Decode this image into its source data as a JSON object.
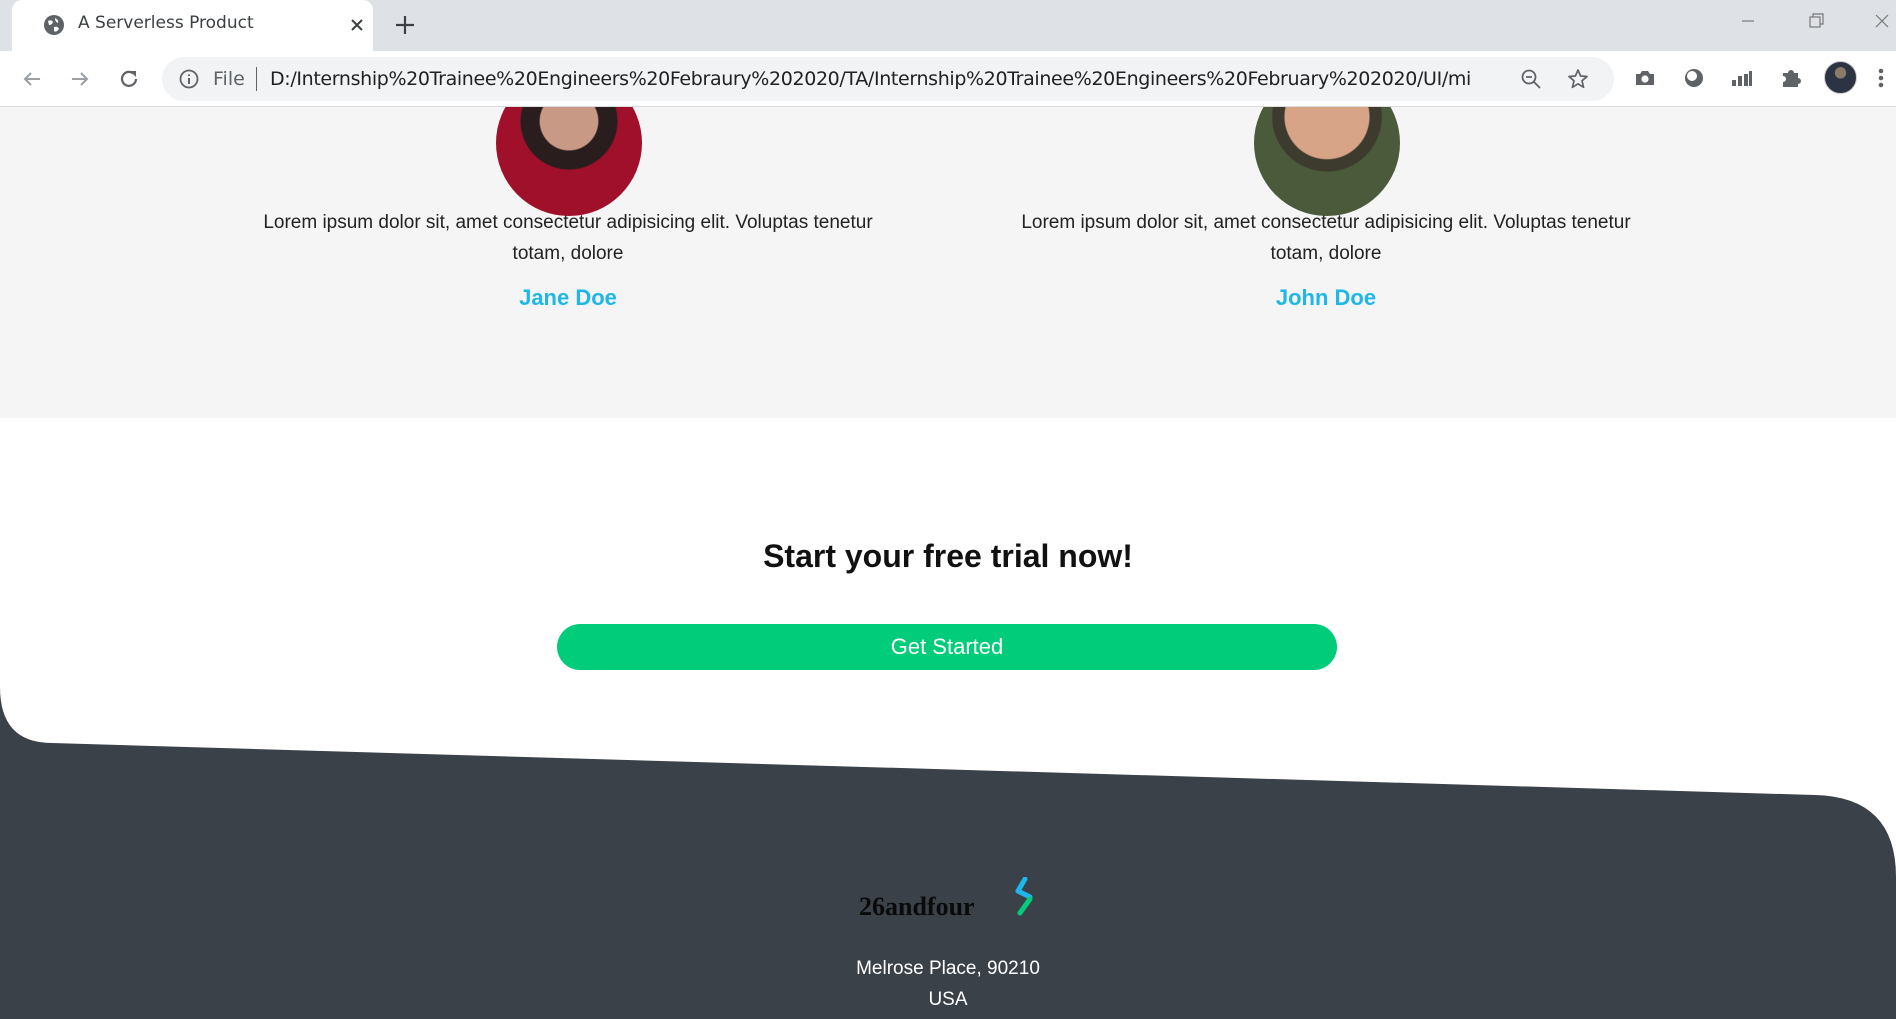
{
  "browser": {
    "tab_title": "A Serverless Product",
    "address_prefix": "File",
    "url": "D:/Internship%20Trainee%20Engineers%20Febraury%202020/TA/Internship%20Trainee%20Engineers%20February%202020/UI/mini..."
  },
  "testimonials": [
    {
      "quote": "Lorem ipsum dolor sit, amet consectetur adipisicing elit. Voluptas tenetur totam, dolore",
      "author": "Jane Doe"
    },
    {
      "quote": "Lorem ipsum dolor sit, amet consectetur adipisicing elit. Voluptas tenetur totam, dolore",
      "author": "John Doe"
    }
  ],
  "cta": {
    "title": "Start your free trial now!",
    "button_label": "Get Started"
  },
  "footer": {
    "brand": "26andfour",
    "address_line1": "Melrose Place, 90210",
    "address_line2": "USA"
  },
  "colors": {
    "accent_blue": "#1fb6ea",
    "cta_green": "#00cc7a",
    "footer_dark": "#3b4149",
    "section_gray": "#f5f5f5"
  },
  "icons": [
    "globe-icon",
    "close-icon",
    "plus-icon",
    "back-arrow-icon",
    "forward-arrow-icon",
    "reload-icon",
    "info-icon",
    "zoom-out-icon",
    "star-icon",
    "camera-icon",
    "extension-circle-icon",
    "chart-icon",
    "puzzle-icon",
    "profile-avatar-icon",
    "kebab-menu-icon",
    "lightning-logo-icon"
  ]
}
